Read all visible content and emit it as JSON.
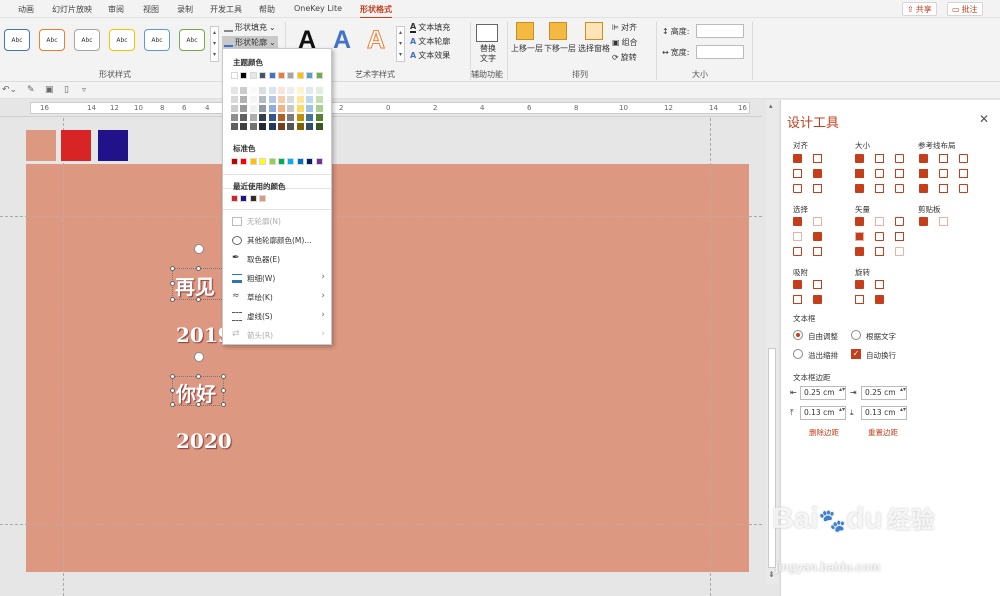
{
  "tabs": [
    "动画",
    "幻灯片放映",
    "审阅",
    "视图",
    "录制",
    "开发工具",
    "帮助",
    "OneKey Lite",
    "形状格式"
  ],
  "top_buttons": {
    "share": "共享",
    "comment": "批注"
  },
  "ribbon": {
    "abc_label": "Abc",
    "shape_fill": "形状填充",
    "shape_outline": "形状轮廓",
    "group_shape_styles": "形状样式",
    "text_fill": "文本填充",
    "text_outline": "文本轮廓",
    "text_effect": "文本效果",
    "big_a": "A",
    "group_wordart": "艺术字样式",
    "alt_text": "替换文字",
    "group_accessibility": "辅助功能",
    "bring_forward": "上移一层",
    "send_backward": "下移一层",
    "selection_pane": "选择窗格",
    "align": "对齐",
    "group": "组合",
    "rotate": "旋转",
    "group_arrange": "排列",
    "height": "高度:",
    "width": "宽度:",
    "group_size": "大小"
  },
  "ruler_labels": [
    "16",
    "14",
    "12",
    "10",
    "8",
    "6",
    "4",
    "2",
    "0",
    "2",
    "4",
    "6",
    "8",
    "10",
    "12",
    "14",
    "16"
  ],
  "slide": {
    "texts": [
      "再见",
      "2019",
      "你好",
      "2020"
    ],
    "swatch_colors": [
      "#dc9880",
      "#d82424",
      "#22128a"
    ]
  },
  "menu": {
    "theme_colors_title": "主题颜色",
    "theme_top": [
      "#ffffff",
      "#000000",
      "#e7e6e6",
      "#44546a",
      "#4472c4",
      "#ed7d31",
      "#a5a5a5",
      "#ffc000",
      "#5b9bd5",
      "#70ad47"
    ],
    "standard_title": "标准色",
    "standard": [
      "#c00000",
      "#ff0000",
      "#ffc000",
      "#ffff00",
      "#92d050",
      "#00b050",
      "#00b0f0",
      "#0070c0",
      "#002060",
      "#7030a0"
    ],
    "recent_title": "最近使用的颜色",
    "recent": [
      "#d82424",
      "#22128a",
      "#3a2a1a",
      "#dc9880"
    ],
    "items": [
      {
        "label": "无轮廓(N)",
        "disabled": true
      },
      {
        "label": "其他轮廓颜色(M)...",
        "disabled": false
      },
      {
        "label": "取色器(E)",
        "disabled": false
      },
      {
        "label": "粗细(W)",
        "disabled": false,
        "submenu": true
      },
      {
        "label": "草绘(K)",
        "disabled": false,
        "submenu": true
      },
      {
        "label": "虚线(S)",
        "disabled": false,
        "submenu": true
      },
      {
        "label": "箭头(R)",
        "disabled": true,
        "submenu": true
      }
    ]
  },
  "panel": {
    "title": "设计工具",
    "sections": {
      "align": "对齐",
      "size": "大小",
      "guides": "参考线布局",
      "select": "选择",
      "vector": "矢量",
      "clipboard": "剪贴板",
      "snap": "吸附",
      "rotate": "旋转",
      "textbox": "文本框",
      "margins": "文本框边距"
    },
    "textbox_options": [
      {
        "label": "自由调整",
        "type": "radio",
        "checked": true
      },
      {
        "label": "根据文字",
        "type": "radio",
        "checked": false
      },
      {
        "label": "溢出缩排",
        "type": "radio",
        "checked": false
      },
      {
        "label": "自动换行",
        "type": "checkbox",
        "checked": true
      }
    ],
    "margins": [
      "0.25 cm",
      "0.25 cm",
      "0.13 cm",
      "0.13 cm"
    ],
    "delete_margins": "删除边距",
    "reset_margins": "重置边距"
  },
  "watermark": {
    "brand": "Bai",
    "brand_tail": "du",
    "cn": "经验",
    "url": "jingyan.baidu.com"
  },
  "accent": "#c43e1c"
}
